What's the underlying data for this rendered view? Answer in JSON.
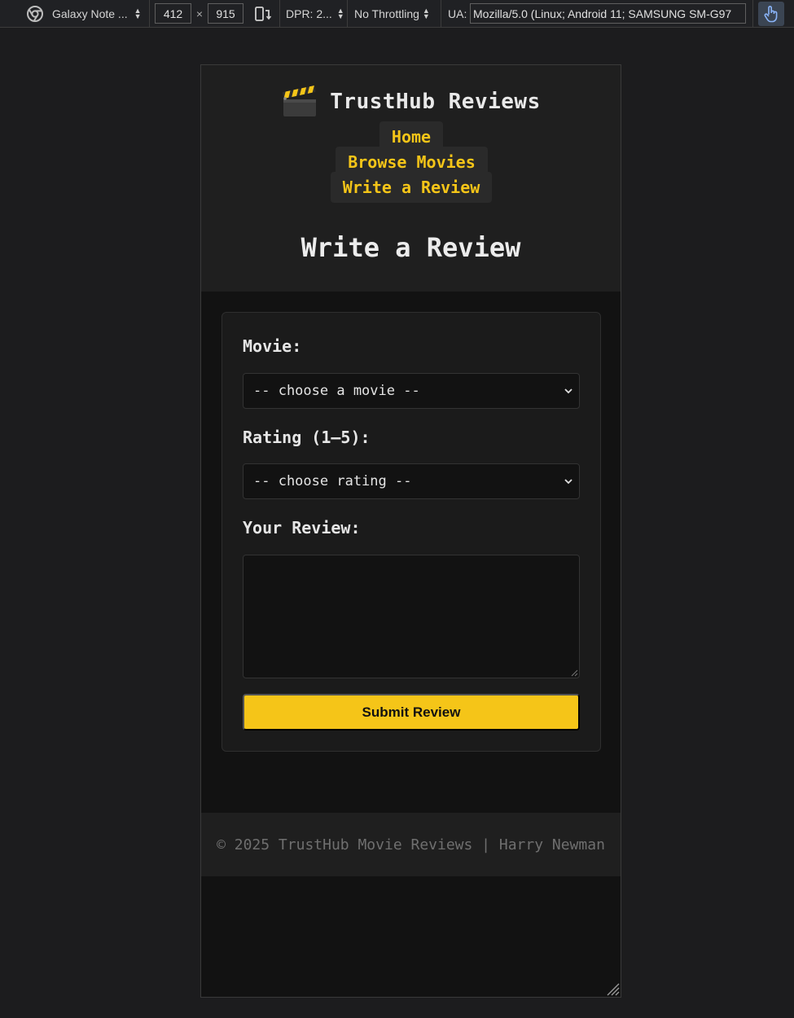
{
  "devtools": {
    "device_name": "Galaxy Note ...",
    "width": "412",
    "times": "×",
    "height": "915",
    "dpr": "DPR: 2...",
    "throttling": "No Throttling",
    "ua_label": "UA:",
    "ua_value": "Mozilla/5.0 (Linux; Android 11; SAMSUNG SM-G97",
    "icons": [
      "chrome-icon",
      "rotate-icon",
      "touch-icon"
    ]
  },
  "site": {
    "brand_icon": "clapperboard-icon",
    "brand_title": "TrustHub Reviews",
    "nav": [
      "Home",
      "Browse Movies",
      "Write a Review"
    ],
    "page_title": "Write a Review",
    "accent_color": "#f5c518",
    "form": {
      "movie_label": "Movie:",
      "movie_value": "-- choose a movie --",
      "rating_label": "Rating (1–5):",
      "rating_value": "-- choose rating --",
      "review_label": "Your Review:",
      "review_value": "",
      "submit_label": "Submit Review"
    },
    "footer": "© 2025 TrustHub Movie Reviews | Harry Newman"
  }
}
